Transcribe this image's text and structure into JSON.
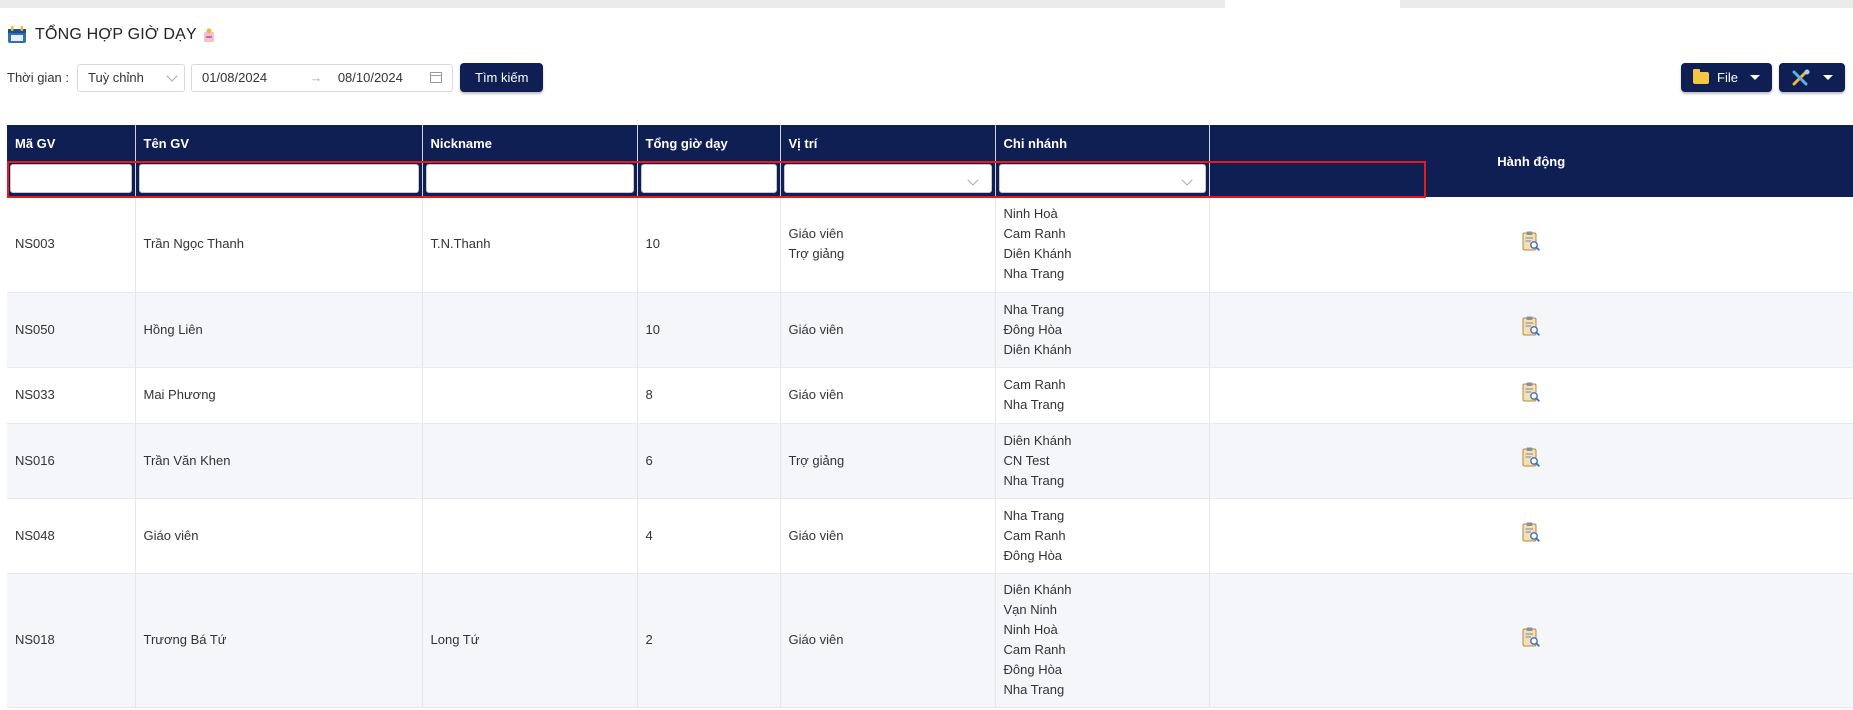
{
  "page": {
    "title": "TỔNG HỢP GIỜ DẠY",
    "title_icon": "calendar-icon",
    "tag_icon": "tag-icon"
  },
  "filters": {
    "time_label": "Thời gian :",
    "time_select_value": "Tuỳ chỉnh",
    "date_from": "01/08/2024",
    "date_arrow": "→",
    "date_to": "08/10/2024",
    "search_button": "Tìm kiếm"
  },
  "toolbar": {
    "file_button": "File",
    "tools_icon": "tools-icon"
  },
  "table": {
    "columns": [
      "Mã GV",
      "Tên GV",
      "Nickname",
      "Tổng giờ dạy",
      "Vị trí",
      "Chi nhánh",
      "Hành động"
    ],
    "rows": [
      {
        "ma": "NS003",
        "ten": "Trần Ngọc Thanh",
        "nick": "T.N.Thanh",
        "gio": "10",
        "vitri": "Giáo viên\nTrợ giảng",
        "chinhanh": "Ninh Hoà\nCam Ranh\nDiên Khánh\nNha Trang"
      },
      {
        "ma": "NS050",
        "ten": "Hồng Liên",
        "nick": "",
        "gio": "10",
        "vitri": "Giáo viên",
        "chinhanh": "Nha Trang\nĐông Hòa\nDiên Khánh"
      },
      {
        "ma": "NS033",
        "ten": "Mai Phương",
        "nick": "",
        "gio": "8",
        "vitri": "Giáo viên",
        "chinhanh": "Cam Ranh\nNha Trang"
      },
      {
        "ma": "NS016",
        "ten": "Trần Văn Khen",
        "nick": "",
        "gio": "6",
        "vitri": "Trợ giảng",
        "chinhanh": "Diên Khánh\nCN Test\nNha Trang"
      },
      {
        "ma": "NS048",
        "ten": "Giáo viên",
        "nick": "",
        "gio": "4",
        "vitri": "Giáo viên",
        "chinhanh": "Nha Trang\nCam Ranh\nĐông Hòa"
      },
      {
        "ma": "NS018",
        "ten": "Trương Bá Tứ",
        "nick": "Long Tứ",
        "gio": "2",
        "vitri": "Giáo viên",
        "chinhanh": "Diên Khánh\nVạn Ninh\nNinh Hoà\nCam Ranh\nĐông Hòa\nNha Trang"
      }
    ],
    "action_icon": "clipboard-search-icon"
  }
}
